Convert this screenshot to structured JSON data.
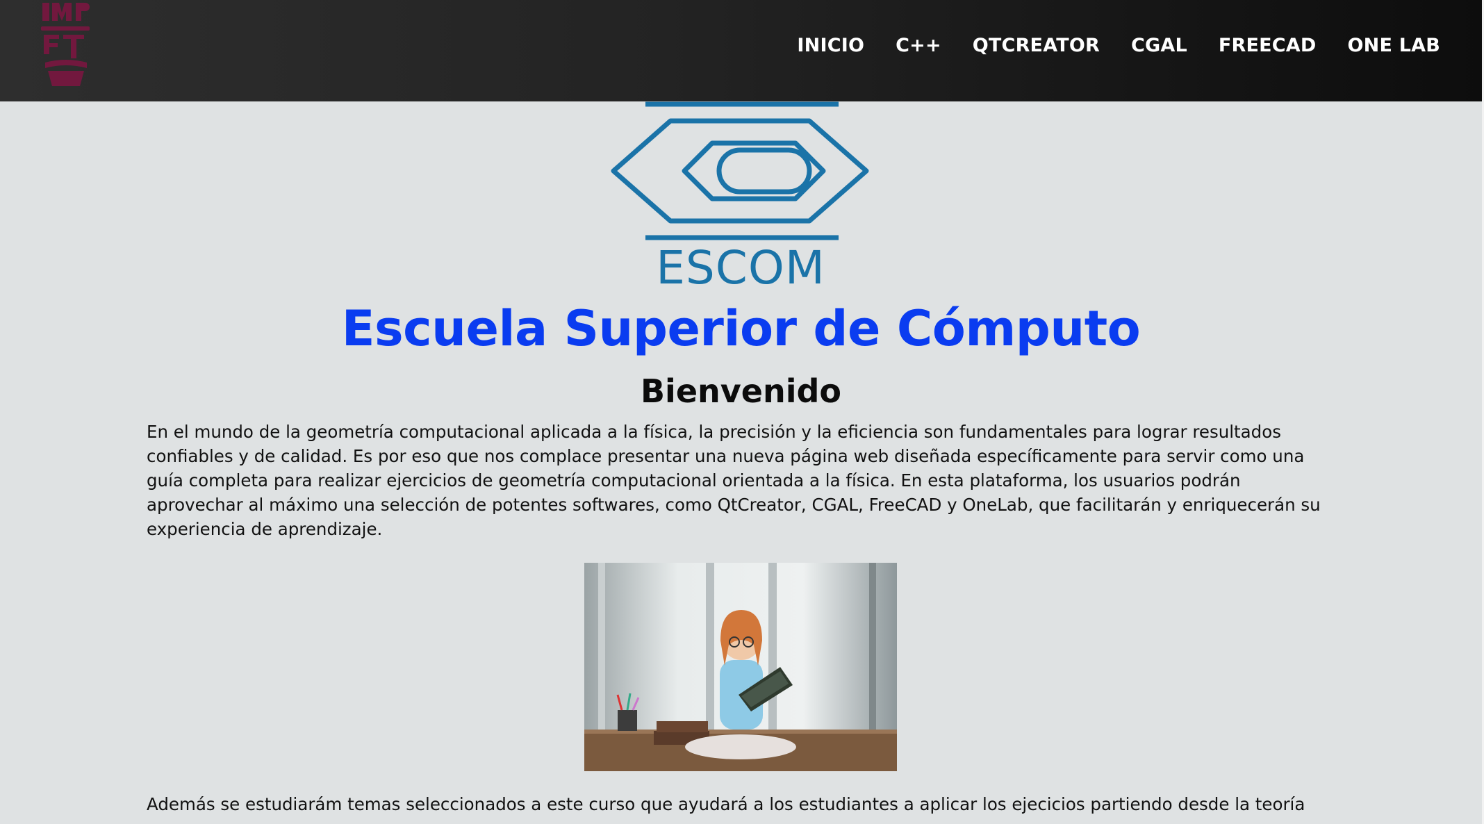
{
  "navbar": {
    "logo_icon": "ipn-logo-icon",
    "links": [
      "INICIO",
      "C++",
      "QTCREATOR",
      "CGAL",
      "FREECAD",
      "ONE LAB"
    ]
  },
  "hero": {
    "logo_text": "ESCOM",
    "title": "Escuela Superior de Cómputo",
    "welcome": "Bienvenido",
    "accent_color": "#0a3cf0",
    "logo_color": "#1a73a8"
  },
  "content": {
    "intro": "En el mundo de la geometría computacional aplicada a la física, la precisión y la eficiencia son fundamentales para lograr resultados confiables y de calidad. Es por eso que nos complace presentar una nueva página web diseñada específicamente para servir como una guía completa para realizar ejercicios de geometría computacional orientada a la física. En esta plataforma, los usuarios podrán aprovechar al máximo una selección de potentes softwares, como QtCreator, CGAL, FreeCAD y OneLab, que facilitarán y enriquecerán su experiencia de aprendizaje.",
    "photo_icon": "girl-reading-book-photo",
    "more": "Además se estudiarám temas seleccionados a este curso que ayudará a los estudiantes a aplicar los ejecicios partiendo desde la teoría"
  }
}
